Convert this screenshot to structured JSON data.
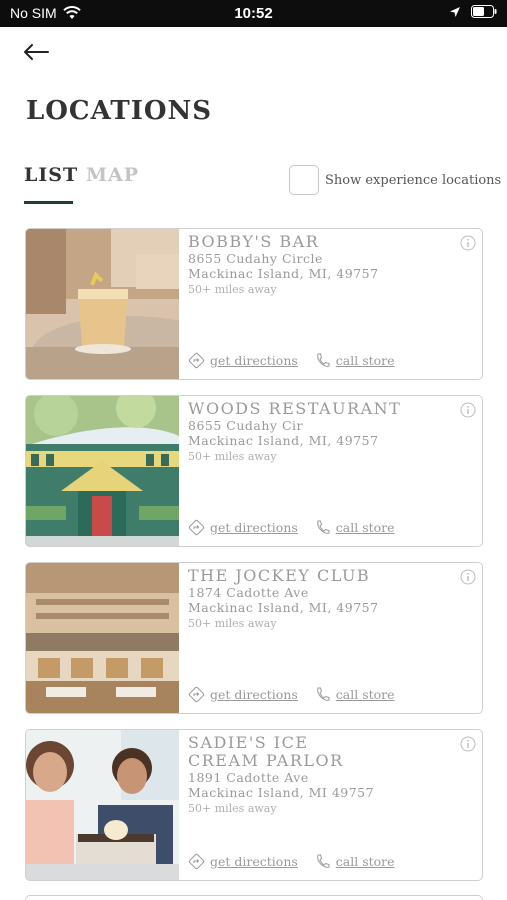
{
  "status_bar": {
    "carrier": "No SIM",
    "time": "10:52"
  },
  "header": {
    "title": "LOCATIONS"
  },
  "tabs": [
    {
      "label": "LIST",
      "active": true
    },
    {
      "label": "MAP",
      "active": false
    }
  ],
  "experience_toggle": {
    "label": "Show experience locations",
    "checked": false
  },
  "actions": {
    "directions_label": "get directions",
    "call_label": "call store"
  },
  "locations": [
    {
      "name": "BOBBY'S BAR",
      "address_line1": "8655 Cudahy Circle",
      "address_line2": "Mackinac Island, MI, 49757",
      "distance": "50+ miles away"
    },
    {
      "name": "WOODS RESTAURANT",
      "address_line1": "8655 Cudahy Cir",
      "address_line2": "Mackinac Island, MI, 49757",
      "distance": "50+ miles away"
    },
    {
      "name": "THE JOCKEY CLUB",
      "address_line1": "1874 Cadotte Ave",
      "address_line2": "Mackinac Island, MI, 49757",
      "distance": "50+ miles away"
    },
    {
      "name": "SADIE'S ICE CREAM PARLOR",
      "address_line1": "1891 Cadotte Ave",
      "address_line2": "Mackinac Island, MI 49757",
      "distance": "50+ miles away"
    }
  ],
  "colors": {
    "accent": "#1e3d33",
    "muted_text": "#9a9a9a",
    "border": "#cfcfcf"
  }
}
